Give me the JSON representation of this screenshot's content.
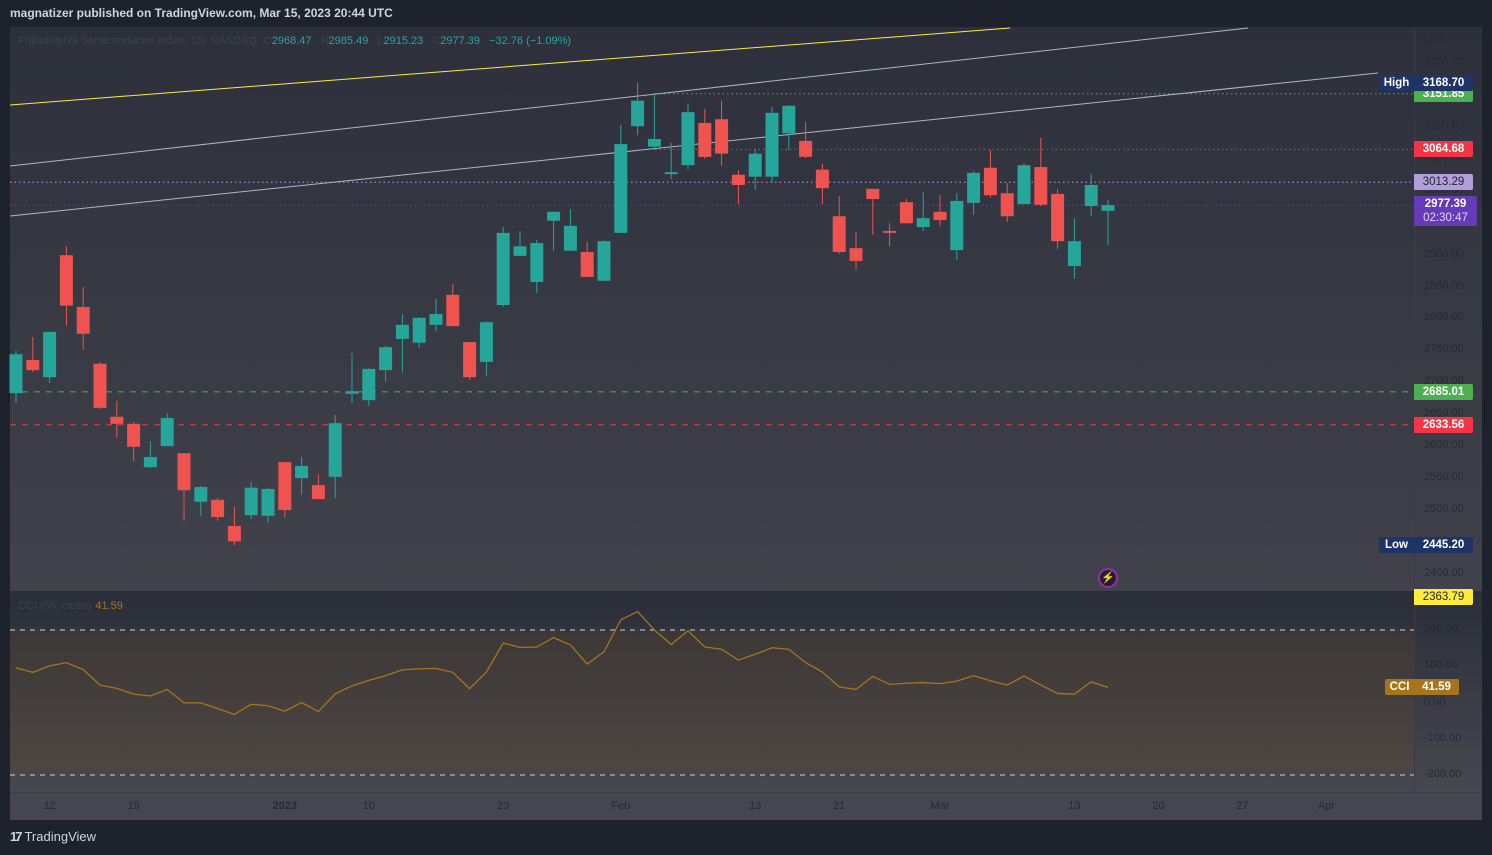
{
  "header": {
    "publisher_line": "magnatizer published on TradingView.com, Mar 15, 2023 20:44 UTC"
  },
  "legend": {
    "symbol": "Philadelphia Semiconductor Index, 1D, NASDAQ",
    "o_label": "O",
    "o": "2968.47",
    "h_label": "H",
    "h": "2985.49",
    "l_label": "L",
    "l": "2915.23",
    "c_label": "C",
    "c": "2977.39",
    "change": "−32.76 (−1.09%)"
  },
  "indicator": {
    "name": "CCI (55, close)",
    "value": "41.59",
    "tag": "CCI"
  },
  "price_axis": {
    "currency": "USD",
    "ticks": [
      "3200.00",
      "3150.00",
      "3100.00",
      "3050.00",
      "3000.00",
      "2950.00",
      "2900.00",
      "2850.00",
      "2800.00",
      "2750.00",
      "2700.00",
      "2650.00",
      "2600.00",
      "2550.00",
      "2500.00",
      "2450.00",
      "2400.00"
    ]
  },
  "cci_axis": {
    "ticks": [
      "200.00",
      "100.00",
      "0.00",
      "-100.00",
      "-200.00"
    ]
  },
  "price_labels": {
    "high": {
      "tag": "High",
      "value": "3168.70"
    },
    "low": {
      "tag": "Low",
      "value": "2445.20"
    },
    "current": {
      "value": "2977.39",
      "countdown": "02:30:47"
    },
    "levels": [
      {
        "value": "3151.85",
        "color": "#4caf50",
        "style": "dotted",
        "bg": "#4caf50",
        "fg": "#ffffff"
      },
      {
        "value": "3064.68",
        "color": "#f23645",
        "style": "dotted",
        "bg": "#f23645",
        "fg": "#ffffff"
      },
      {
        "value": "3013.29",
        "color": "#b39ddb",
        "style": "dotted",
        "bg": "#b39ddb",
        "fg": "#1e222d"
      },
      {
        "value": "2685.01",
        "color": "#4caf50",
        "style": "dashed",
        "bg": "#4caf50",
        "fg": "#ffffff"
      },
      {
        "value": "2633.56",
        "color": "#f23645",
        "style": "dashed",
        "bg": "#f23645",
        "fg": "#ffffff"
      },
      {
        "value": "2363.79",
        "color": "#ffeb3b",
        "style": "none",
        "bg": "#ffeb3b",
        "fg": "#1e222d"
      }
    ]
  },
  "footer": {
    "brand": "TradingView"
  },
  "colors": {
    "up": "#26a69a",
    "down": "#ef5350",
    "cci": "#a6741a",
    "current": "#673ab7",
    "high_low": "#1e3366",
    "trend_yellow": "#ffeb3b",
    "trend_gray": "#b2b5be"
  },
  "chart_data": {
    "type": "candlestick",
    "title": "Philadelphia Semiconductor Index, 1D, NASDAQ",
    "ylim": [
      2350,
      3240
    ],
    "x_ticks": [
      {
        "bar": 2,
        "label": "12"
      },
      {
        "bar": 7,
        "label": "19"
      },
      {
        "bar": 16,
        "label": "2023"
      },
      {
        "bar": 21,
        "label": "10"
      },
      {
        "bar": 29,
        "label": "23"
      },
      {
        "bar": 36,
        "label": "Feb"
      },
      {
        "bar": 44,
        "label": "13"
      },
      {
        "bar": 49,
        "label": "21"
      },
      {
        "bar": 55,
        "label": "Mar"
      },
      {
        "bar": 63,
        "label": "13"
      },
      {
        "bar": 68,
        "label": "20"
      },
      {
        "bar": 73,
        "label": "27"
      },
      {
        "bar": 78,
        "label": "Apr"
      }
    ],
    "ohlc": [
      [
        2683,
        2749,
        2668,
        2744
      ],
      [
        2735,
        2771,
        2716,
        2719
      ],
      [
        2708,
        2779,
        2699,
        2779
      ],
      [
        2899,
        2913,
        2788,
        2820
      ],
      [
        2818,
        2849,
        2751,
        2776
      ],
      [
        2729,
        2732,
        2658,
        2660
      ],
      [
        2646,
        2671,
        2613,
        2635
      ],
      [
        2635,
        2638,
        2577,
        2599
      ],
      [
        2567,
        2608,
        2566,
        2583
      ],
      [
        2600,
        2652,
        2600,
        2644
      ],
      [
        2589,
        2589,
        2483,
        2531
      ],
      [
        2513,
        2538,
        2491,
        2536
      ],
      [
        2516,
        2519,
        2483,
        2489
      ],
      [
        2475,
        2505,
        2445,
        2451
      ],
      [
        2492,
        2544,
        2486,
        2535
      ],
      [
        2491,
        2535,
        2480,
        2533
      ],
      [
        2575,
        2575,
        2489,
        2500
      ],
      [
        2550,
        2583,
        2524,
        2569
      ],
      [
        2539,
        2556,
        2517,
        2517
      ],
      [
        2552,
        2649,
        2519,
        2636
      ],
      [
        2682,
        2746,
        2668,
        2686
      ],
      [
        2672,
        2722,
        2663,
        2721
      ],
      [
        2719,
        2757,
        2701,
        2755
      ],
      [
        2768,
        2807,
        2715,
        2790
      ],
      [
        2762,
        2802,
        2754,
        2801
      ],
      [
        2790,
        2831,
        2780,
        2807
      ],
      [
        2837,
        2854,
        2788,
        2788
      ],
      [
        2763,
        2763,
        2704,
        2708
      ],
      [
        2732,
        2796,
        2710,
        2794
      ],
      [
        2821,
        2943,
        2818,
        2934
      ],
      [
        2898,
        2937,
        2898,
        2913
      ],
      [
        2857,
        2923,
        2840,
        2918
      ],
      [
        2953,
        2968,
        2906,
        2967
      ],
      [
        2906,
        2971,
        2906,
        2945
      ],
      [
        2904,
        2920,
        2865,
        2865
      ],
      [
        2859,
        2923,
        2859,
        2921
      ],
      [
        2934,
        3103,
        2934,
        3073
      ],
      [
        3101,
        3169,
        3087,
        3141
      ],
      [
        3069,
        3153,
        3064,
        3081
      ],
      [
        3026,
        3075,
        3018,
        3029
      ],
      [
        3040,
        3137,
        3033,
        3123
      ],
      [
        3106,
        3128,
        3050,
        3053
      ],
      [
        3112,
        3141,
        3039,
        3058
      ],
      [
        3025,
        3032,
        2979,
        3009
      ],
      [
        3022,
        3065,
        3001,
        3058
      ],
      [
        3022,
        3131,
        3012,
        3122
      ],
      [
        3090,
        3134,
        3064,
        3133
      ],
      [
        3078,
        3108,
        3051,
        3053
      ],
      [
        3033,
        3042,
        2979,
        3004
      ],
      [
        2960,
        2992,
        2901,
        2904
      ],
      [
        2910,
        2935,
        2876,
        2890
      ],
      [
        3003,
        3003,
        2931,
        2987
      ],
      [
        2937,
        2949,
        2913,
        2934
      ],
      [
        2982,
        2987,
        2949,
        2949
      ],
      [
        2943,
        2998,
        2937,
        2957
      ],
      [
        2967,
        2993,
        2945,
        2954
      ],
      [
        2907,
        2996,
        2892,
        2984
      ],
      [
        2981,
        3031,
        2962,
        3028
      ],
      [
        3036,
        3064,
        2989,
        2993
      ],
      [
        2996,
        3012,
        2951,
        2960
      ],
      [
        2979,
        3043,
        2979,
        3040
      ],
      [
        3037,
        3083,
        2976,
        2978
      ],
      [
        2995,
        3003,
        2909,
        2921
      ],
      [
        2882,
        2957,
        2862,
        2921
      ],
      [
        2976,
        3026,
        2960,
        3009
      ],
      [
        2968.47,
        2985.49,
        2915.23,
        2977.39
      ]
    ],
    "cci": {
      "period": 55,
      "source": "close",
      "ylim": [
        -200,
        200
      ],
      "bands": [
        200,
        -200
      ],
      "values": [
        96,
        83,
        101,
        110,
        91,
        48,
        39,
        23,
        18,
        36,
        -1,
        -1,
        -17,
        -33,
        -5,
        -9,
        -24,
        0,
        -25,
        24,
        46,
        61,
        74,
        90,
        93,
        94,
        83,
        38,
        84,
        164,
        152,
        153,
        179,
        159,
        106,
        140,
        228,
        251,
        200,
        160,
        198,
        153,
        147,
        117,
        133,
        151,
        147,
        110,
        84,
        43,
        36,
        72,
        50,
        53,
        55,
        52,
        59,
        74,
        60,
        48,
        73,
        48,
        25,
        23,
        57,
        41.59
      ]
    }
  }
}
